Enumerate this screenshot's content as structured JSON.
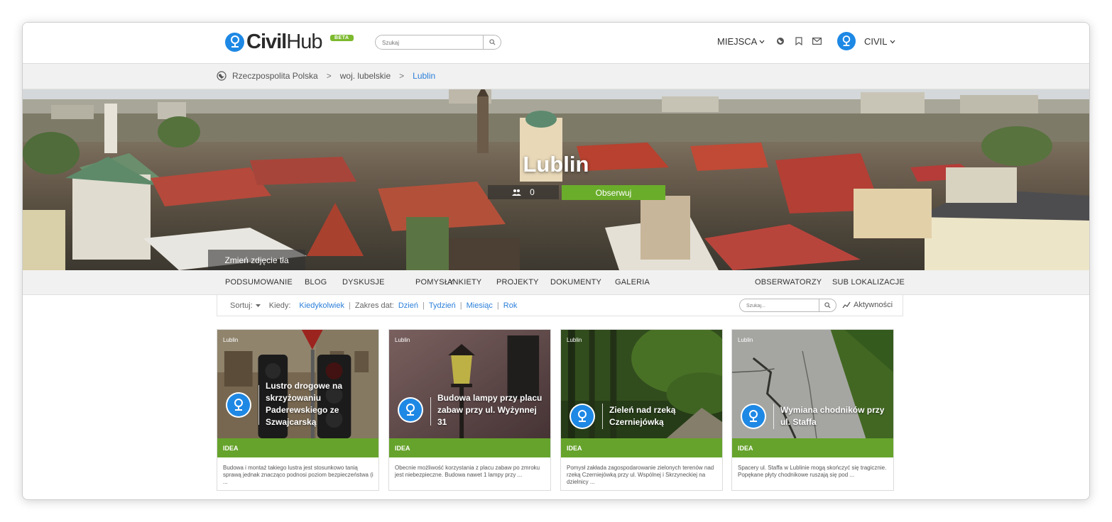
{
  "header": {
    "logo_text_civil": "Civil",
    "logo_text_hub": "Hub",
    "beta_badge": "BETA",
    "search_placeholder": "Szukaj",
    "nav_places": "MIEJSCA",
    "user_name": "CIVIL"
  },
  "breadcrumb": {
    "items": [
      "Rzeczpospolita Polska",
      "woj. lubelskie",
      "Lublin"
    ],
    "separator": ">"
  },
  "hero": {
    "title": "Lublin",
    "followers_count": "0",
    "follow_button": "Obserwuj",
    "change_background": "Zmień zdjęcie tła"
  },
  "tabs": {
    "left": [
      "PODSUMOWANIE",
      "BLOG",
      "DYSKUSJE",
      "POMYSŁY",
      "ANKIETY",
      "PROJEKTY",
      "DOKUMENTY",
      "GALERIA"
    ],
    "right": [
      "OBSERWATORZY",
      "SUB LOKALIZACJE"
    ]
  },
  "filter": {
    "sort_label": "Sortuj:",
    "when_label": "Kiedy:",
    "when_value": "Kiedykolwiek",
    "range_label": "Zakres dat:",
    "ranges": [
      "Dzień",
      "Tydzień",
      "Miesiąc",
      "Rok"
    ],
    "search_placeholder": "Szukaj...",
    "activity_label": "Aktywności"
  },
  "cards": [
    {
      "location": "Lublin",
      "title": "Lustro drogowe na skrzyżowaniu Paderewskiego ze Szwajcarską",
      "tag": "IDEA",
      "description": "Budowa i montaż takiego lustra jest stosunkowo tanią sprawą jednak znacząco podnosi poziom bezpieczeństwa (i ..."
    },
    {
      "location": "Lublin",
      "title": "Budowa lampy przy placu zabaw przy ul. Wyżynnej 31",
      "tag": "IDEA",
      "description": "Obecnie możliwość korzystania z placu zabaw po zmroku jest niebezpieczne. Budowa nawet 1 lampy przy ..."
    },
    {
      "location": "Lublin",
      "title": "Zieleń nad rzeką Czerniejówką",
      "tag": "IDEA",
      "description": "Pomysł zakłada zagospodarowanie zielonych terenów nad rzeką Czerniejówką przy ul. Wspólnej i Skrzyneckiej na dzielnicy ..."
    },
    {
      "location": "Lublin",
      "title": "Wymiana chodników przy ul. Staffa",
      "tag": "IDEA",
      "description": "Spacery ul. Staffa w Lublinie mogą skończyć się tragicznie. Popękane płyty chodnikowe ruszają się pod ..."
    }
  ],
  "colors": {
    "brand_blue": "#1e88e5",
    "accent_green": "#66a32c",
    "link_blue": "#2b7fd9"
  }
}
